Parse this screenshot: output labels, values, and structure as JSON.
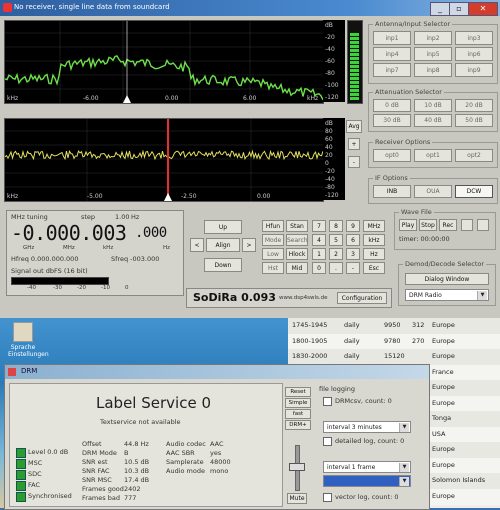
{
  "window_title": "No receiver, single line data from soundcard",
  "spectrum1": {
    "db_ticks": [
      "0",
      "-20",
      "-40",
      "-60",
      "-80",
      "-100",
      "-120"
    ],
    "db_unit": "dB",
    "x_ticks": [
      "-6.00",
      "0.00",
      "6.00"
    ],
    "x_unit": "kHz",
    "x_end": "kHz"
  },
  "spectrum2": {
    "db_ticks": [
      "80",
      "60",
      "40",
      "20",
      "0",
      "-20",
      "-40",
      "-60",
      "-80",
      "-100",
      "-120"
    ],
    "db_unit": "dB",
    "x_ticks": [
      "-5.00",
      "-2.50",
      "0.00"
    ],
    "x_unit": "kHz"
  },
  "side_buttons": {
    "avg": "Avg",
    "plus": "+",
    "minus": "-"
  },
  "antenna": {
    "title": "Antenna/Input Selector",
    "buttons": [
      "inp1",
      "inp2",
      "inp3",
      "inp4",
      "inp5",
      "inp6",
      "inp7",
      "inp8",
      "inp9"
    ]
  },
  "attenuation": {
    "title": "Attenuation Selector",
    "buttons": [
      "0 dB",
      "10 dB",
      "20 dB",
      "30 dB",
      "40 dB",
      "50 dB"
    ]
  },
  "receiver_options": {
    "title": "Receiver Options",
    "buttons": [
      "opt0",
      "opt1",
      "opt2"
    ]
  },
  "if_options": {
    "title": "IF Options",
    "buttons": [
      "INB",
      "OUA",
      "DCW"
    ]
  },
  "wave_file": {
    "title": "Wave File",
    "buttons": [
      "Play",
      "Stop",
      "Rec"
    ],
    "timer_label": "timer: 00:00:00"
  },
  "demod": {
    "title": "Demod/Decode Selector",
    "dialog_button": "Dialog Window",
    "mode": "DRM Radio"
  },
  "tuning": {
    "label": "MHz tuning",
    "step_label": "step",
    "step_value": "1.00",
    "step_unit": "Hz",
    "frequency": "-0.000.003",
    "frequency_suffix": ".000",
    "units": [
      "GHz",
      "MHz",
      "kHz",
      "Hz"
    ],
    "hfreq": "Hfreq 0.000.000.000",
    "sfreq": "Sfreq -003.000",
    "signal_label": "Signal out dbFS (16 bit)",
    "scale": [
      "-40",
      "-30",
      "-20",
      "-10",
      "0"
    ]
  },
  "nav": {
    "up": "Up",
    "align": "Align",
    "down": "Down",
    "left": "<",
    "right": ">"
  },
  "modes": [
    "Hfun",
    "Stan",
    "Mode",
    "Search",
    "Low",
    "Hlock",
    "Hst",
    "Mid"
  ],
  "keypad": [
    "7",
    "8",
    "9",
    "MHz",
    "4",
    "5",
    "6",
    "kHz",
    "1",
    "2",
    "3",
    "Hz",
    "0",
    ".",
    "-",
    "Esc"
  ],
  "brand": {
    "name": "SoDiRa 0.093",
    "site": "www.dsp4swls.de",
    "config_button": "Configuration"
  },
  "desktop": {
    "icon1_label": "Sprache Einstellungen"
  },
  "schedule": [
    {
      "time": "1745-1945",
      "days": "daily",
      "freq": "9950",
      "kw": "312",
      "region": "Europe"
    },
    {
      "time": "1800-1905",
      "days": "daily",
      "freq": "9780",
      "kw": "270",
      "region": "Europe"
    },
    {
      "time": "1830-2000",
      "days": "daily",
      "freq": "15120",
      "kw": "",
      "region": "Europe"
    },
    {
      "time": "",
      "days": "",
      "freq": "",
      "kw": "",
      "region": "France"
    },
    {
      "time": "",
      "days": "",
      "freq": "",
      "kw": "",
      "region": "Europe"
    },
    {
      "time": "",
      "days": "",
      "freq": "",
      "kw": "",
      "region": "Europe"
    },
    {
      "time": "",
      "days": "",
      "freq": "",
      "kw": "",
      "region": "Tonga"
    },
    {
      "time": "",
      "days": "",
      "freq": "",
      "kw": "",
      "region": "USA"
    },
    {
      "time": "",
      "days": "",
      "freq": "",
      "kw": "",
      "region": "Europe"
    },
    {
      "time": "",
      "days": "",
      "freq": "",
      "kw": "",
      "region": "Europe"
    },
    {
      "time": "",
      "days": "",
      "freq": "",
      "kw": "",
      "region": "Solomon Islands"
    },
    {
      "time": "",
      "days": "",
      "freq": "",
      "kw": "",
      "region": "Europe"
    }
  ],
  "drm": {
    "title": "DRM",
    "service_label": "Label Service 0",
    "text_service": "Textservice not available",
    "status": [
      {
        "label": "Level 0.0 dB",
        "color": "#2c9c2c"
      },
      {
        "label": "MSC",
        "color": "#2c9c2c"
      },
      {
        "label": "SDC",
        "color": "#2c9c2c"
      },
      {
        "label": "FAC",
        "color": "#2c9c2c"
      },
      {
        "label": "Synchronised",
        "color": "#2c9c2c"
      }
    ],
    "params_left": [
      {
        "k": "Offset",
        "v": "44.8 Hz"
      },
      {
        "k": "DRM Mode",
        "v": "B"
      },
      {
        "k": "SNR est",
        "v": "10.5 dB"
      },
      {
        "k": "SNR FAC",
        "v": "10.3 dB"
      },
      {
        "k": "SNR MSC",
        "v": "17.4 dB"
      },
      {
        "k": "Frames good",
        "v": "2402"
      },
      {
        "k": "Frames bad",
        "v": "777"
      }
    ],
    "params_right": [
      {
        "k": "Audio codec",
        "v": "AAC"
      },
      {
        "k": "AAC SBR",
        "v": "yes"
      },
      {
        "k": "Samplerate",
        "v": "48000"
      },
      {
        "k": "Audio mode",
        "v": "mono"
      }
    ],
    "buttons": [
      "Reset",
      "Simple",
      "fast MSC",
      "DRM+"
    ],
    "mute": "Mute",
    "file_logging": "file logging",
    "drmcsv": "DRMcsv, count: 0",
    "interval1": "interval 3 minutes",
    "detailed": "detailed log, count: 0",
    "interval2": "interval 1 frame",
    "vector": "vector log, count: 0"
  }
}
